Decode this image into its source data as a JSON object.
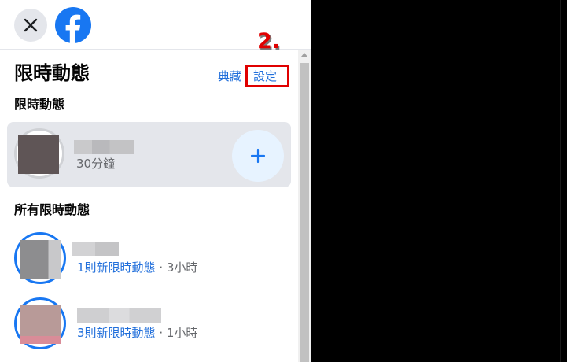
{
  "header": {
    "close_icon": "close-icon",
    "logo_icon": "facebook-logo-icon",
    "brand_color": "#1877f2"
  },
  "annotation": {
    "step_label": "2."
  },
  "page": {
    "title": "限時動態",
    "archive_link": "典藏",
    "settings_link": "設定"
  },
  "my_story": {
    "section_title": "限時動態",
    "time_label": "30分鐘",
    "add_icon": "plus-icon"
  },
  "all_stories": {
    "section_title": "所有限時動態",
    "items": [
      {
        "count_text": "1則新限時動態",
        "time_text": " · 3小時"
      },
      {
        "count_text": "3則新限時動態",
        "time_text": " · 1小時"
      }
    ]
  },
  "colors": {
    "link": "#216fdb",
    "highlight": "#e00000",
    "ring": "#1877f2"
  }
}
